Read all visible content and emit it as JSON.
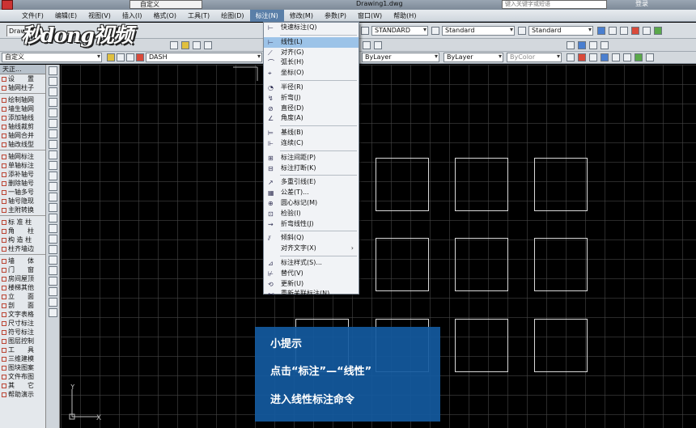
{
  "titlebar": {
    "workspace": "自定义",
    "document": "Drawing1.dwg",
    "search_placeholder": "键入关键字或短语",
    "login": "登录"
  },
  "menubar": [
    {
      "label": "文件(F)"
    },
    {
      "label": "编辑(E)"
    },
    {
      "label": "视图(V)"
    },
    {
      "label": "插入(I)"
    },
    {
      "label": "格式(O)"
    },
    {
      "label": "工具(T)"
    },
    {
      "label": "绘图(D)"
    },
    {
      "label": "标注(N)"
    },
    {
      "label": "修改(M)"
    },
    {
      "label": "参数(P)"
    },
    {
      "label": "窗口(W)"
    },
    {
      "label": "帮助(H)"
    }
  ],
  "toolbar": {
    "doc_tab": "Draw",
    "textstyle": "STANDARD",
    "dimstyle": "Standard",
    "tablestyle": "Standard",
    "layer_workspace": "自定义",
    "layer": "DASH",
    "color": "ByLayer",
    "linetype": "ByLayer",
    "plotstyle": "ByColor"
  },
  "logo": {
    "text": "秒dong视频"
  },
  "palette": {
    "header": "天正...",
    "groups": [
      [
        "设　　置",
        "轴网柱子"
      ],
      [
        "绘制轴网",
        "墙生轴网",
        "添加轴线",
        "轴线裁剪",
        "轴网合并",
        "轴改线型"
      ],
      [
        "轴网标注",
        "单轴标注",
        "添补轴号",
        "删除轴号",
        "一轴多号",
        "轴号隐现",
        "主附转换"
      ],
      [
        "标 准 柱",
        "角　　柱",
        "构 造 柱",
        "柱齐墙边"
      ],
      [
        "墙　　体",
        "门　　窗",
        "房间屋顶",
        "楼梯其他",
        "立　　面",
        "剖　　面",
        "文字表格",
        "尺寸标注",
        "符号标注",
        "图层控制",
        "工　　具",
        "三维建模",
        "图块图案",
        "文件布图",
        "其　　它",
        "帮助演示"
      ]
    ]
  },
  "dropdown": {
    "items": [
      {
        "label": "快速标注(Q)",
        "icon": "quick-dim-icon",
        "glyph": "⊢"
      },
      {
        "sep": true
      },
      {
        "label": "线性(L)",
        "icon": "linear-dim-icon",
        "glyph": "⊢",
        "highlight": true
      },
      {
        "label": "对齐(G)",
        "icon": "aligned-dim-icon",
        "glyph": "⟋"
      },
      {
        "label": "弧长(H)",
        "icon": "arc-length-icon",
        "glyph": "⌒"
      },
      {
        "label": "坐标(O)",
        "icon": "ordinate-icon",
        "glyph": "⌖"
      },
      {
        "sep": true
      },
      {
        "label": "半径(R)",
        "icon": "radius-icon",
        "glyph": "◔"
      },
      {
        "label": "折弯(J)",
        "icon": "jogged-icon",
        "glyph": "↯"
      },
      {
        "label": "直径(D)",
        "icon": "diameter-icon",
        "glyph": "⊘"
      },
      {
        "label": "角度(A)",
        "icon": "angle-icon",
        "glyph": "∠"
      },
      {
        "sep": true
      },
      {
        "label": "基线(B)",
        "icon": "baseline-icon",
        "glyph": "⊨"
      },
      {
        "label": "连续(C)",
        "icon": "continue-icon",
        "glyph": "⊩"
      },
      {
        "sep": true
      },
      {
        "label": "标注间距(P)",
        "icon": "dim-space-icon",
        "glyph": "⊞"
      },
      {
        "label": "标注打断(K)",
        "icon": "dim-break-icon",
        "glyph": "⊟"
      },
      {
        "sep": true
      },
      {
        "label": "多重引线(E)",
        "icon": "multileader-icon",
        "glyph": "↗"
      },
      {
        "label": "公差(T)...",
        "icon": "tolerance-icon",
        "glyph": "▦"
      },
      {
        "label": "圆心标记(M)",
        "icon": "center-mark-icon",
        "glyph": "⊕"
      },
      {
        "label": "检验(I)",
        "icon": "inspect-icon",
        "glyph": "⊡"
      },
      {
        "label": "折弯线性(J)",
        "icon": "jogged-linear-icon",
        "glyph": "⇝"
      },
      {
        "sep": true
      },
      {
        "label": "倾斜(Q)",
        "icon": "oblique-icon",
        "glyph": "⫽"
      },
      {
        "label": "对齐文字(X)",
        "icon": "",
        "glyph": "",
        "submenu": true
      },
      {
        "sep": true
      },
      {
        "label": "标注样式(S)...",
        "icon": "dim-style-icon",
        "glyph": "⊿"
      },
      {
        "label": "替代(V)",
        "icon": "override-icon",
        "glyph": "⊬"
      },
      {
        "label": "更新(U)",
        "icon": "update-icon",
        "glyph": "⟲"
      },
      {
        "label": "重新关联标注(N)",
        "icon": "reassociate-icon",
        "glyph": "⊷"
      }
    ]
  },
  "tip": {
    "title": "小提示",
    "line1": "点击“标注”—“线性”",
    "line2": "进入线性标注命令"
  },
  "ucs": {
    "x_label": "X",
    "y_label": "Y"
  }
}
